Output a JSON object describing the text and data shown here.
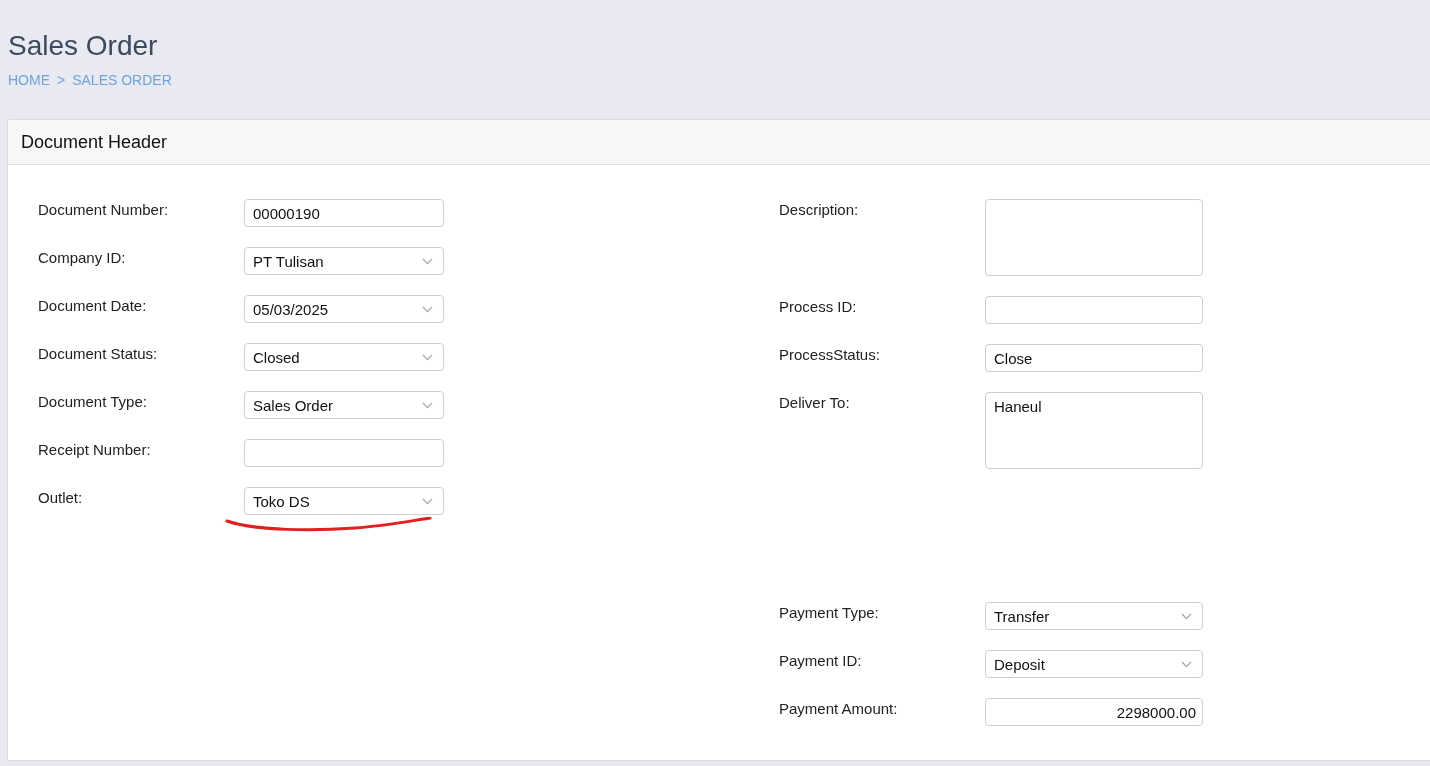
{
  "page": {
    "title": "Sales Order"
  },
  "breadcrumb": [
    "HOME",
    ">",
    "SALES ORDER"
  ],
  "panel": {
    "title": "Document Header"
  },
  "left_fields": [
    {
      "label": "Document Number:",
      "kind": "text",
      "value": "00000190",
      "underlined": false
    },
    {
      "label": "Company ID:",
      "kind": "select",
      "value": "PT Tulisan",
      "underlined": false
    },
    {
      "label": "Document Date:",
      "kind": "select",
      "value": "05/03/2025",
      "underlined": false
    },
    {
      "label": "Document Status:",
      "kind": "select",
      "value": "Closed",
      "underlined": false
    },
    {
      "label": "Document Type:",
      "kind": "select",
      "value": "Sales Order",
      "underlined": false
    },
    {
      "label": "Receipt Number:",
      "kind": "text",
      "underlined": false
    },
    {
      "label": "Outlet:",
      "kind": "select",
      "value": "Toko DS",
      "underlined": true
    }
  ],
  "right_fields": [
    {
      "label": "Description:",
      "kind": "textarea"
    },
    {
      "label": "Process ID:",
      "kind": "text"
    },
    {
      "label": "ProcessStatus:",
      "kind": "text",
      "value": "Close"
    },
    {
      "label": "Deliver To:",
      "kind": "textarea",
      "value": "Haneul"
    }
  ],
  "payment_fields": [
    {
      "label": "Payment Type:",
      "kind": "select",
      "value": "Transfer"
    },
    {
      "label": "Payment ID:",
      "kind": "select",
      "value": "Deposit"
    },
    {
      "label": "Payment Amount:",
      "kind": "number",
      "value": "2298000.00"
    }
  ]
}
